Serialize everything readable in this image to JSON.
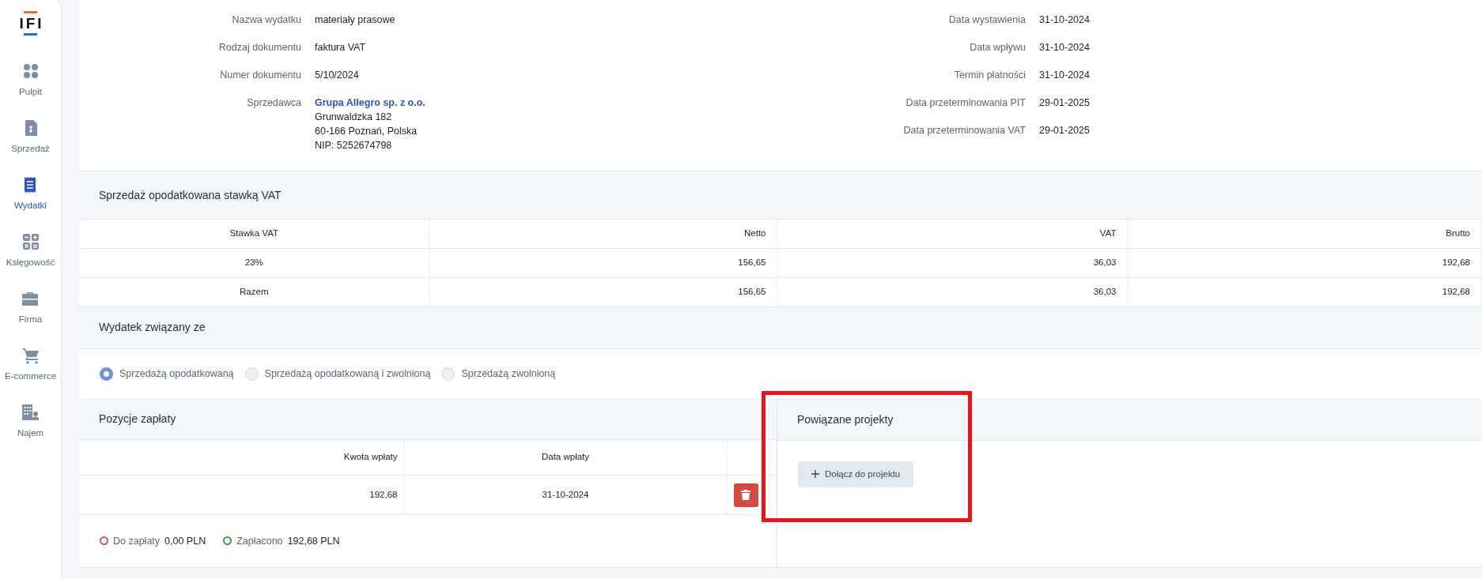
{
  "sidebar": {
    "logo": "IFI",
    "items": [
      {
        "kind": "dots",
        "label": "Pulpit",
        "selected": false
      },
      {
        "kind": "invoice",
        "label": "Sprzedaż",
        "selected": false
      },
      {
        "kind": "receipt",
        "label": "Wydatki",
        "selected": true
      },
      {
        "kind": "calc",
        "label": "Księgowość",
        "selected": false
      },
      {
        "kind": "briefcase",
        "label": "Firma",
        "selected": false
      },
      {
        "kind": "cart",
        "label": "E-commerce",
        "selected": false
      },
      {
        "kind": "building",
        "label": "Najem",
        "selected": false
      }
    ]
  },
  "details_left": [
    {
      "label": "Nazwa wydatku",
      "lines": [
        "materiały prasowe"
      ]
    },
    {
      "label": "Rodzaj dokumentu",
      "lines": [
        "faktura VAT"
      ]
    },
    {
      "label": "Numer dokumentu",
      "lines": [
        "5/10/2024"
      ]
    },
    {
      "label": "Sprzedawca",
      "link": "Grupa Allegro sp. z o.o.",
      "lines": [
        "Grunwaldzka 182",
        "60-166 Poznań, Polska",
        "NIP: 5252674798"
      ]
    }
  ],
  "details_right": [
    {
      "label": "Data wystawienia",
      "lines": [
        "31-10-2024"
      ]
    },
    {
      "label": "Data wpływu",
      "lines": [
        "31-10-2024"
      ]
    },
    {
      "label": "Termin płatności",
      "lines": [
        "31-10-2024"
      ]
    },
    {
      "label": "Data przeterminowania PIT",
      "lines": [
        "29-01-2025"
      ]
    },
    {
      "label": "Data przeterminowania VAT",
      "lines": [
        "29-01-2025"
      ]
    }
  ],
  "vat_section": {
    "title": "Sprzedaż opodatkowana stawką VAT",
    "columns": [
      "Stawka VAT",
      "Netto",
      "VAT",
      "Brutto"
    ],
    "rows": [
      [
        "23%",
        "156,65",
        "36,03",
        "192,68"
      ],
      [
        "Razem",
        "156,65",
        "36,03",
        "192,68"
      ]
    ]
  },
  "related_to": {
    "title": "Wydatek związany ze",
    "options": [
      {
        "label": "Sprzedażą opodatkowaną",
        "selected": true
      },
      {
        "label": "Sprzedażą opodatkowaną i zwolnioną",
        "selected": false
      },
      {
        "label": "Sprzedażą zwolnioną",
        "selected": false
      }
    ]
  },
  "payments": {
    "title": "Pozycje zapłaty",
    "columns": [
      "Kwota wpłaty",
      "Data wpłaty"
    ],
    "rows": [
      {
        "amount": "192,68",
        "date": "31-10-2024"
      }
    ],
    "summary": [
      {
        "label": "Do zapłaty",
        "value": "0,00 PLN",
        "color": "#d9534f"
      },
      {
        "label": "Zapłacono",
        "value": "192,68 PLN",
        "color": "#3a9a4a"
      }
    ]
  },
  "projects": {
    "title": "Powiązane projekty",
    "button": "Dołącz do projektu"
  }
}
